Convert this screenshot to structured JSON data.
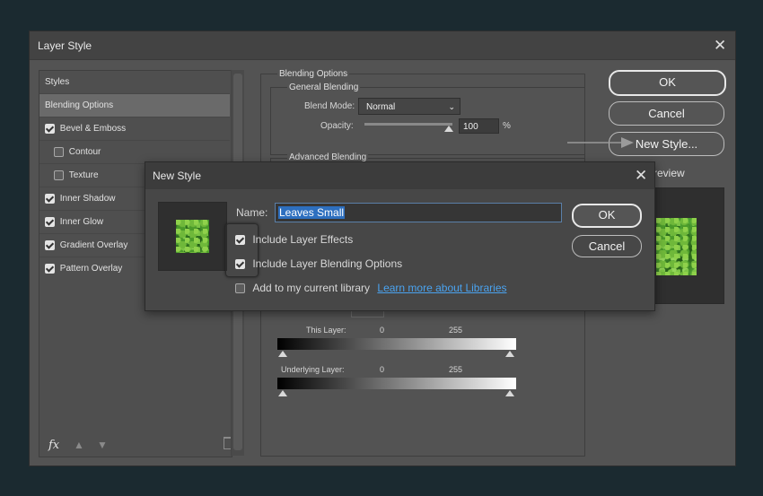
{
  "layer_style": {
    "title": "Layer Style",
    "sidebar": {
      "header": "Styles",
      "items": [
        {
          "label": "Blending Options",
          "checked": null
        },
        {
          "label": "Bevel & Emboss",
          "checked": true
        },
        {
          "label": "Contour",
          "checked": false
        },
        {
          "label": "Texture",
          "checked": false
        },
        {
          "label": "Inner Shadow",
          "checked": true
        },
        {
          "label": "Inner Glow",
          "checked": true
        },
        {
          "label": "Gradient Overlay",
          "checked": true
        },
        {
          "label": "Pattern Overlay",
          "checked": true
        }
      ],
      "fx_label": "fx"
    },
    "blending": {
      "section_title": "Blending Options",
      "general_title": "General Blending",
      "blend_mode_label": "Blend Mode:",
      "blend_mode_value": "Normal",
      "opacity_label": "Opacity:",
      "opacity_value": "100",
      "opacity_unit": "%",
      "advanced_title": "Advanced Blending",
      "this_layer_label": "This Layer:",
      "underlying_label": "Underlying Layer:",
      "range_min": "0",
      "range_max": "255"
    },
    "buttons": {
      "ok": "OK",
      "cancel": "Cancel",
      "new_style": "New Style..."
    },
    "preview_label": "review"
  },
  "new_style": {
    "title": "New Style",
    "name_label": "Name:",
    "name_value": "Leaves Small",
    "options": [
      {
        "label": "Include Layer Effects",
        "checked": true
      },
      {
        "label": "Include Layer Blending Options",
        "checked": true
      },
      {
        "label": "Add to my current library",
        "checked": false
      }
    ],
    "learn_more_link": "Learn more about Libraries",
    "ok": "OK",
    "cancel": "Cancel"
  }
}
